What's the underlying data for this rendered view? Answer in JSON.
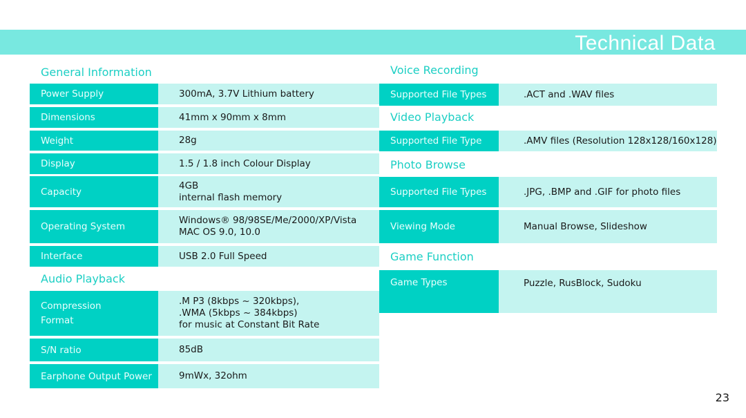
{
  "header": {
    "title": "Technical Data"
  },
  "accent_colors": {
    "header_band": "#78e8e0",
    "label_cell": "#00d1c4",
    "value_cell": "#c4f4f0",
    "section_title": "#1ccfc4"
  },
  "general": {
    "title": "General Information",
    "rows": [
      {
        "label": "Power Supply",
        "value": [
          "300mA, 3.7V Lithium battery"
        ]
      },
      {
        "label": "Dimensions",
        "value": [
          "41mm x 90mm x 8mm"
        ]
      },
      {
        "label": "Weight",
        "value": [
          "28g"
        ]
      },
      {
        "label": "Display",
        "value": [
          "1.5 / 1.8 inch Colour Display"
        ]
      },
      {
        "label": "Capacity",
        "value": [
          "4GB",
          "internal flash memory"
        ]
      },
      {
        "label": "Operating System",
        "value": [
          "Windows® 98/98SE/Me/2000/XP/Vista",
          "MAC OS 9.0, 10.0"
        ]
      },
      {
        "label": "Interface",
        "value": [
          "USB 2.0 Full Speed"
        ]
      }
    ]
  },
  "audio": {
    "title": "Audio Playback",
    "rows": [
      {
        "label": [
          "Compression",
          "Format"
        ],
        "value": [
          ".M P3 (8kbps ~ 320kbps),",
          ".WMA (5kbps ~ 384kbps)",
          "for music at Constant Bit Rate"
        ]
      },
      {
        "label": "S/N ratio",
        "value": [
          "85dB"
        ]
      },
      {
        "label": "Earphone Output Power",
        "value": [
          "9mWx, 32ohm"
        ]
      }
    ]
  },
  "voice": {
    "title": "Voice Recording",
    "rows": [
      {
        "label": "Supported File Types",
        "value": [
          ".ACT and .WAV files"
        ]
      }
    ]
  },
  "video": {
    "title": "Video Playback",
    "rows": [
      {
        "label": "Supported File Type",
        "value": [
          ".AMV  files (Resolution 128x128/160x128)"
        ]
      }
    ]
  },
  "photo": {
    "title": "Photo Browse",
    "rows": [
      {
        "label": "Supported File Types",
        "value": [
          ".JPG, .BMP and .GIF for photo files"
        ]
      },
      {
        "label": "Viewing Mode",
        "value": [
          "Manual Browse, Slideshow"
        ]
      }
    ]
  },
  "game": {
    "title": "Game Function",
    "rows": [
      {
        "label": "Game Types",
        "value": [
          "Puzzle, RusBlock, Sudoku"
        ]
      }
    ]
  },
  "page_number": "23"
}
